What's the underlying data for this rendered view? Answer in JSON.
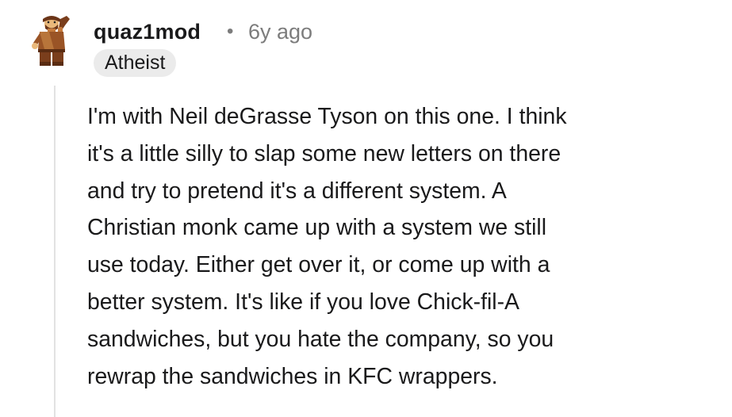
{
  "comment": {
    "author": "quaz1mod",
    "separator": "•",
    "age": "6y ago",
    "flair": "Atheist",
    "avatar_icon": "lego-minifigure-avatar-icon",
    "body_lines": [
      "I'm with Neil deGrasse Tyson on this one. I think",
      "it's a little silly to slap some new letters on there",
      "and try to pretend it's a different system. A",
      "Christian monk came up with a system we still",
      "use today. Either get over it, or come up with a",
      "better system. It's like if you love Chick-fil-A",
      "sandwiches, but you hate the company, so you",
      "rewrap the sandwiches in KFC wrappers."
    ]
  },
  "colors": {
    "text": "#1a1a1b",
    "meta": "#7c7c7c",
    "flair_bg": "#ebebeb",
    "thread_line": "#e2e2e2",
    "avatar_brown": "#8b4a22"
  }
}
